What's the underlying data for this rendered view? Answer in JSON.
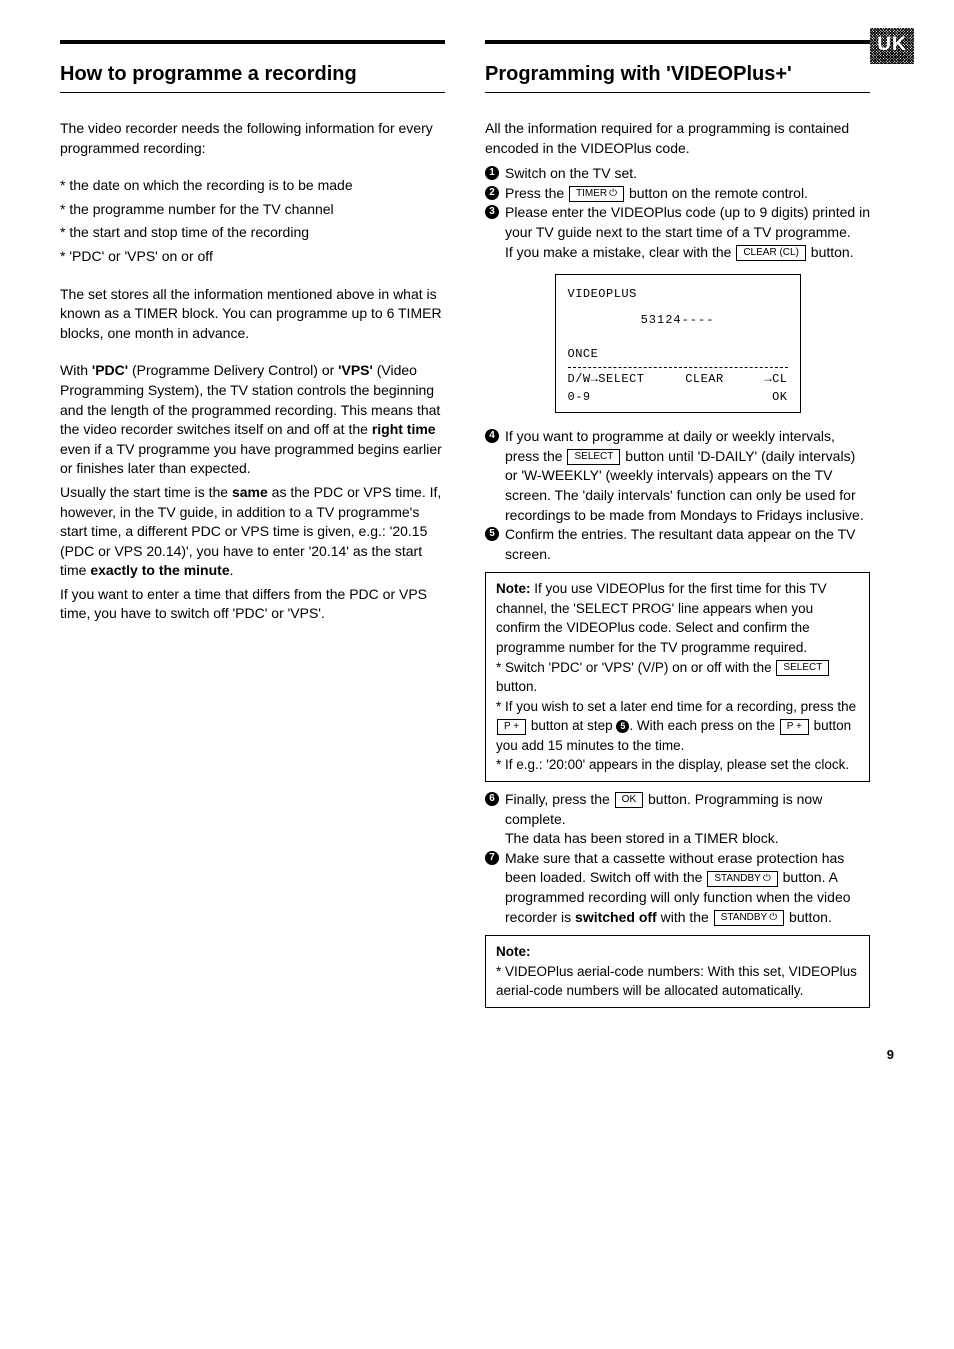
{
  "badge": "UK",
  "page_number": "9",
  "left": {
    "title": "How to programme a recording",
    "intro": "The video recorder needs the following information for every programmed recording:",
    "bullets": [
      "* the date on which the recording is to be made",
      "* the programme number for the TV channel",
      "* the start and stop time of the recording",
      "* 'PDC' or 'VPS' on or off"
    ],
    "store_text": "The set stores all the information mentioned above in what is known as a TIMER block. You can programme up to 6 TIMER blocks, one month in advance.",
    "pdc_1": "With ",
    "pdc_bold1": "'PDC'",
    "pdc_2": " (Programme Delivery Control) or ",
    "pdc_bold2": "'VPS'",
    "pdc_3": " (Video Programming System), the TV station controls the beginning and the length of the programmed recording. This means that the video recorder switches itself on and off at the ",
    "pdc_bold3": "right time",
    "pdc_4": " even if a TV programme you have programmed begins earlier or finishes later than expected.",
    "usually_1": "Usually the start time is the ",
    "usually_bold": "same",
    "usually_2": " as the PDC or VPS time. If, however, in the TV guide, in addition to a TV programme's start time, a different PDC or VPS time is given, e.g.: '20.15 (PDC or VPS 20.14)', you have to enter '20.14' as the start time ",
    "usually_bold2": "exactly to the minute",
    "usually_3": ".",
    "switchoff": "If you want to enter a time that differs from the PDC or VPS time, you have to switch off 'PDC' or 'VPS'."
  },
  "right": {
    "title": "Programming with 'VIDEOPlus+'",
    "intro": "All the information required for a programming is contained encoded in the VIDEOPlus code.",
    "step1": "Switch on the TV set.",
    "step2a": "Press the ",
    "btn_timer": "TIMER",
    "step2b": " button on the remote control.",
    "step3a": "Please enter the VIDEOPlus code (up to 9 digits) printed in your TV guide next to the start time of a TV programme.",
    "step3b": "If you make a mistake, clear with the ",
    "btn_clear": "CLEAR (CL)",
    "step3c": " button.",
    "display": {
      "title": "VIDEOPLUS",
      "code": "53124----",
      "once": "ONCE",
      "dw": "D/W→SELECT",
      "clear": "CLEAR",
      "cl": "→CL",
      "num": "0-9",
      "ok": "OK"
    },
    "step4a": "If you want to programme at daily or weekly intervals, press the ",
    "btn_select": "SELECT",
    "step4b": " button until 'D-DAILY' (daily intervals) or 'W-WEEKLY' (weekly intervals) appears on the TV screen. The 'daily intervals' function can only be used for recordings to be made from Mondays to Fridays inclusive.",
    "step5": "Confirm the entries. The resultant data appear on the TV screen.",
    "note1": {
      "a": "Note:",
      "b": " If you use VIDEOPlus for the first time for this TV channel, the 'SELECT PROG' line appears when you confirm the VIDEOPlus code. Select and confirm the programme number for the TV programme required.",
      "c": "* Switch 'PDC' or 'VPS' (V/P) on or off with the ",
      "d": " button.",
      "e": "* If you wish to set a later end time for a recording, press the ",
      "btn_pplus": "P +",
      "f": " button at step ",
      "g": ". With each press on the ",
      "h": " button you add 15 minutes to the time.",
      "i": "* If e.g.: '20:00' appears in the display, please set the clock."
    },
    "step6a": "Finally, press the ",
    "btn_ok": "OK",
    "step6b": " button. Programming is now complete.",
    "step6c": "The data has been stored in a TIMER block.",
    "step7a": "Make sure that a cassette without erase protection has been loaded. Switch off with the ",
    "btn_standby": "STANDBY",
    "step7b": " button. A programmed recording will only function when the video recorder is ",
    "step7bold": "switched off",
    "step7c": " with the ",
    "step7d": " button.",
    "note2": {
      "a": "Note:",
      "b": "* VIDEOPlus aerial-code numbers: With this set, VIDEOPlus aerial-code numbers will be allocated automatically."
    }
  }
}
